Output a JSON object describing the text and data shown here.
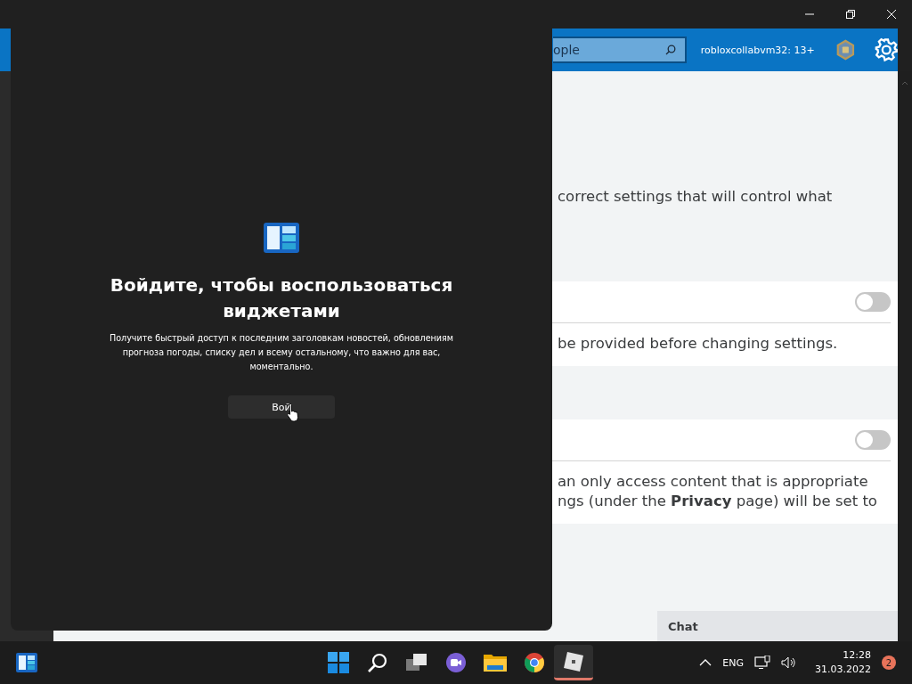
{
  "header": {
    "search": {
      "value": "ople"
    },
    "user": "robloxcollabvm32: 13+"
  },
  "settings": {
    "intro": "correct settings that will control what",
    "sections": [
      {
        "toggle": {
          "on": false
        },
        "note": "be provided before changing settings."
      },
      {
        "toggle": {
          "on": false
        },
        "note": "an only access content that is appropriate\nngs (under the **Privacy** page) will be set to"
      }
    ]
  },
  "chat": {
    "label": "Chat"
  },
  "widgets_panel": {
    "title": "Войдите, чтобы воспользоваться виджетами",
    "description": "Получите быстрый доступ к последним заголовкам новостей, обновлениям прогноза погоды, списку дел и всему остальному, что важно для вас, моментально.",
    "button": "Вой"
  },
  "taskbar": {
    "apps": [
      {
        "kind": "start",
        "active": false
      },
      {
        "kind": "search",
        "active": false
      },
      {
        "kind": "taskview",
        "active": false
      },
      {
        "kind": "chat",
        "active": false
      },
      {
        "kind": "explorer",
        "active": false
      },
      {
        "kind": "browser",
        "active": false
      },
      {
        "kind": "game",
        "active": true
      }
    ],
    "tray": {
      "language": "ENG",
      "time": "12:28",
      "date": "31.03.2022",
      "notifications": "2"
    }
  }
}
